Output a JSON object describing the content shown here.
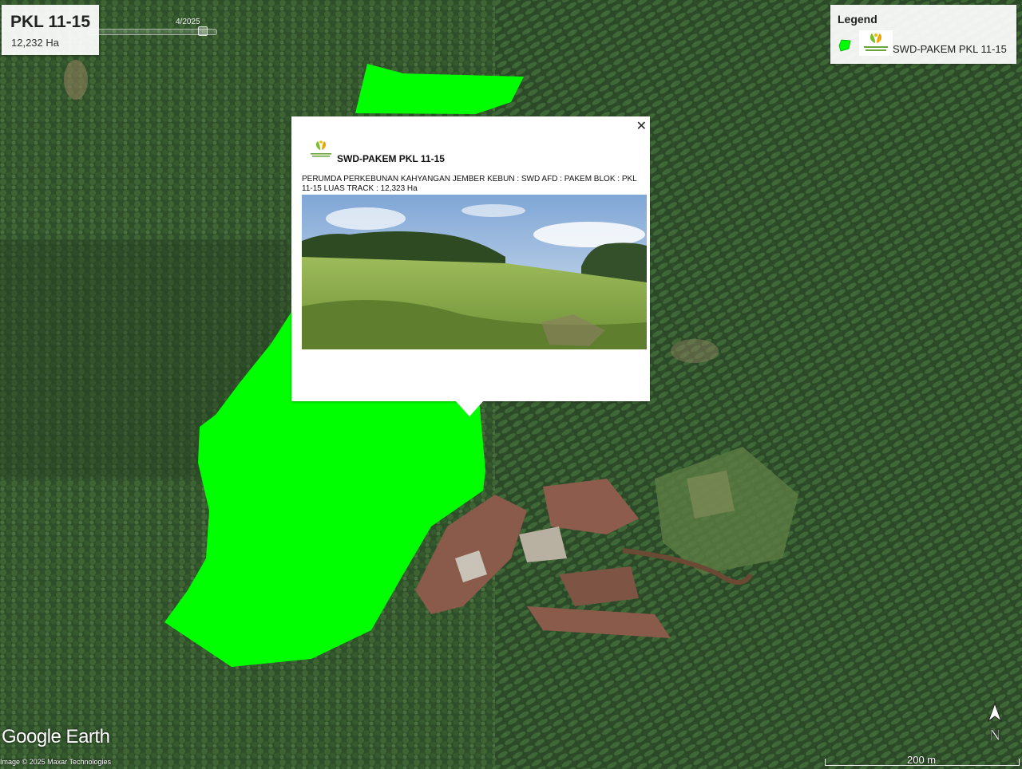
{
  "title_card": {
    "title": "PKL 11-15",
    "area": "12,232 Ha"
  },
  "timeline": {
    "date": "4/2025"
  },
  "legend": {
    "heading": "Legend",
    "item_label": "SWD-PAKEM PKL 11-15",
    "item_color": "#00ff00",
    "icon": "polygon-swatch-icon"
  },
  "popup": {
    "title": "SWD-PAKEM PKL 11-15",
    "description": "PERUMDA PERKEBUNAN KAHYANGAN JEMBER KEBUN : SWD AFD : PAKEM BLOK : PKL 11-15 LUAS TRACK : 12,323 Ha",
    "close_icon": "close-icon"
  },
  "map": {
    "polygon_color": "#00ff00",
    "brand": "Google Earth",
    "credit": "Image © 2025 Maxar Technologies",
    "scale_label": "200 m",
    "compass_label": "N"
  }
}
